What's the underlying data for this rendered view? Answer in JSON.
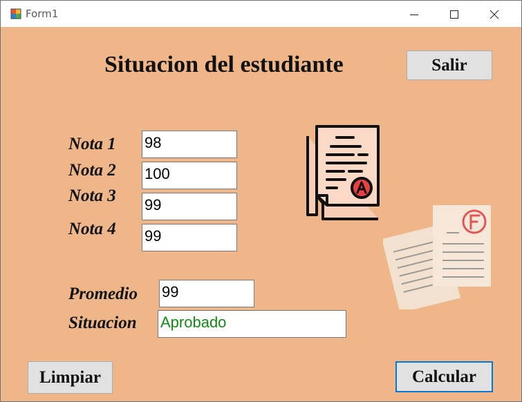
{
  "window": {
    "title": "Form1",
    "controls": [
      "minimize-icon",
      "maximize-icon",
      "close-icon"
    ]
  },
  "form": {
    "heading": "Situacion del estudiante",
    "exit_button": "Salir",
    "clear_button": "Limpiar",
    "calculate_button": "Calcular",
    "background_color": "#efb68a",
    "grades": [
      {
        "label": "Nota 1",
        "value": "98"
      },
      {
        "label": "Nota 2",
        "value": "100"
      },
      {
        "label": "Nota 3",
        "value": "99"
      },
      {
        "label": "Nota 4",
        "value": "99"
      }
    ],
    "average": {
      "label": "Promedio",
      "value": "99"
    },
    "status": {
      "label": "Situacion",
      "value": "Aprobado",
      "color": "#138a13"
    }
  },
  "images": [
    "graded-document-a-icon",
    "graded-papers-f-icon"
  ]
}
